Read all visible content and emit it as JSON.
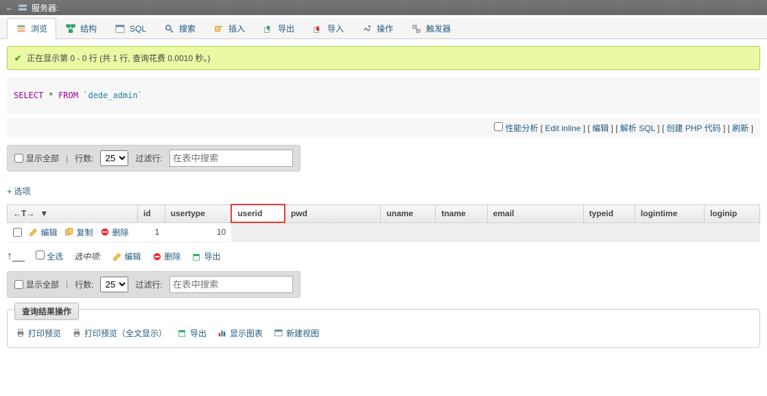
{
  "titlebar": {
    "label": "服务器:"
  },
  "tabs": {
    "browse": "浏览",
    "structure": "结构",
    "sql": "SQL",
    "search": "搜索",
    "insert": "插入",
    "export": "导出",
    "import": "导入",
    "operations": "操作",
    "triggers": "触发器"
  },
  "success": {
    "text": "正在显示第 0 - 0 行 (共 1 行, 查询花费 0.0010 秒。)"
  },
  "sql": {
    "select": "SELECT",
    "star": "*",
    "from": "FROM",
    "table": "`dede_admin`"
  },
  "action_links": {
    "profiling": "性能分析",
    "edit_inline": "Edit inline",
    "edit": "编辑",
    "explain": "解析 SQL",
    "php": "创建 PHP 代码",
    "refresh": "刷新"
  },
  "controls": {
    "show_all": "显示全部",
    "rows_label": "行数:",
    "rows_value": "25",
    "filter_label": "过滤行:",
    "filter_placeholder": "在表中搜索"
  },
  "options_link": "+ 选项",
  "columns": {
    "sort_arrows": "←T→",
    "id": "id",
    "usertype": "usertype",
    "userid": "userid",
    "pwd": "pwd",
    "uname": "uname",
    "tname": "tname",
    "email": "email",
    "typeid": "typeid",
    "logintime": "logintime",
    "loginip": "loginip"
  },
  "row_actions": {
    "edit": "编辑",
    "copy": "复制",
    "delete": "删除"
  },
  "data_rows": [
    {
      "id": "1",
      "usertype": "10",
      "userid": "",
      "pwd": "",
      "uname": "",
      "tname": "",
      "email": "",
      "typeid": "",
      "logintime": "",
      "loginip": ""
    }
  ],
  "bulk": {
    "check_all": "全选",
    "with_selected": "选中项:",
    "edit": "编辑",
    "delete": "删除",
    "export": "导出"
  },
  "results_ops": {
    "legend": "查询结果操作",
    "print_preview": "打印预览",
    "print_full": "打印预览（全文显示）",
    "export": "导出",
    "chart": "显示图表",
    "create_view": "新建视图"
  }
}
